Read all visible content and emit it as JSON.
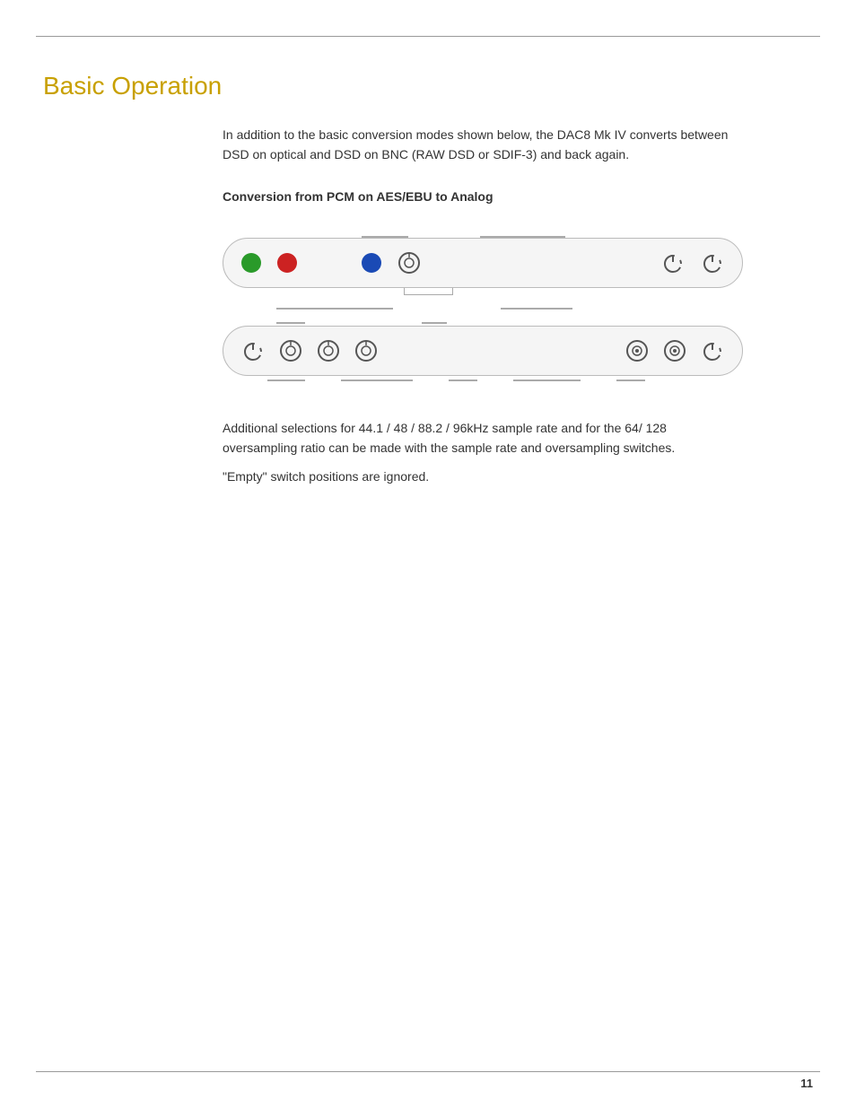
{
  "page": {
    "title": "Basic Operation",
    "page_number": "11",
    "top_rule": true,
    "bottom_rule": true
  },
  "content": {
    "intro_paragraph": "In addition to the basic conversion modes shown below, the DAC8 Mk IV converts between DSD on optical and DSD on BNC (RAW DSD or SDIF-3) and back again.",
    "section_heading": "Conversion from PCM on AES/EBU to Analog",
    "additional_paragraph_1": "Additional selections for 44.1 / 48 / 88.2 / 96kHz sample rate and for the 64/ 128 oversampling ratio can be made with the sample rate and oversampling switches.",
    "additional_paragraph_2": "\"Empty\" switch positions are ignored."
  }
}
